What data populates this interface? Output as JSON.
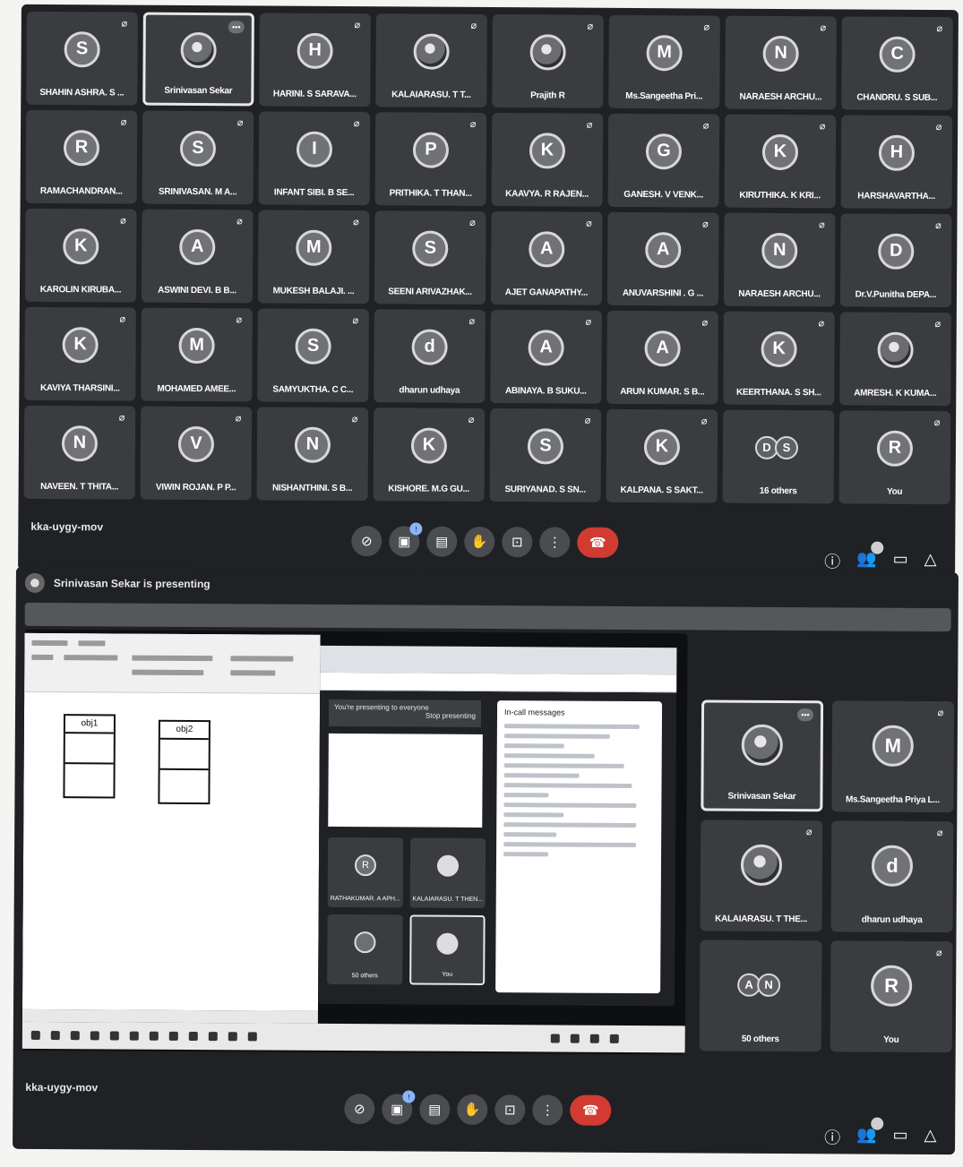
{
  "top": {
    "participants": [
      {
        "initial": "S",
        "name": "SHAHIN ASHRA. S ..."
      },
      {
        "initial": "",
        "name": "Srinivasan Sekar",
        "photo": true,
        "active": true,
        "more": "•••"
      },
      {
        "initial": "H",
        "name": "HARINI. S SARAVA..."
      },
      {
        "initial": "",
        "name": "KALAIARASU. T T...",
        "photo": true
      },
      {
        "initial": "",
        "name": "Prajith R",
        "photo": true
      },
      {
        "initial": "M",
        "name": "Ms.Sangeetha Pri..."
      },
      {
        "initial": "N",
        "name": "NARAESH ARCHU..."
      },
      {
        "initial": "C",
        "name": "CHANDRU. S SUB..."
      },
      {
        "initial": "R",
        "name": "RAMACHANDRAN..."
      },
      {
        "initial": "S",
        "name": "SRINIVASAN. M A..."
      },
      {
        "initial": "I",
        "name": "INFANT SIBI. B SE..."
      },
      {
        "initial": "P",
        "name": "PRITHIKA. T THAN..."
      },
      {
        "initial": "K",
        "name": "KAAVYA. R RAJEN..."
      },
      {
        "initial": "G",
        "name": "GANESH. V VENK..."
      },
      {
        "initial": "K",
        "name": "KIRUTHIKA. K KRI..."
      },
      {
        "initial": "H",
        "name": "HARSHAVARTHA..."
      },
      {
        "initial": "K",
        "name": "KAROLIN KIRUBA..."
      },
      {
        "initial": "A",
        "name": "ASWINI DEVI. B B..."
      },
      {
        "initial": "M",
        "name": "MUKESH BALAJI. ..."
      },
      {
        "initial": "S",
        "name": "SEENI ARIVAZHAK..."
      },
      {
        "initial": "A",
        "name": "AJET GANAPATHY..."
      },
      {
        "initial": "A",
        "name": "ANUVARSHINI . G ..."
      },
      {
        "initial": "N",
        "name": "NARAESH ARCHU..."
      },
      {
        "initial": "D",
        "name": "Dr.V.Punitha DEPA..."
      },
      {
        "initial": "K",
        "name": "KAVIYA THARSINI..."
      },
      {
        "initial": "M",
        "name": "MOHAMED AMEE..."
      },
      {
        "initial": "S",
        "name": "SAMYUKTHA. C C..."
      },
      {
        "initial": "d",
        "name": "dharun udhaya"
      },
      {
        "initial": "A",
        "name": "ABINAYA. B SUKU..."
      },
      {
        "initial": "A",
        "name": "ARUN KUMAR. S B..."
      },
      {
        "initial": "K",
        "name": "KEERTHANA. S SH..."
      },
      {
        "initial": "",
        "name": "AMRESH. K KUMA...",
        "photo": true
      },
      {
        "initial": "N",
        "name": "NAVEEN. T THITA..."
      },
      {
        "initial": "V",
        "name": "VIWIN ROJAN. P P..."
      },
      {
        "initial": "N",
        "name": "NISHANTHINI. S B..."
      },
      {
        "initial": "K",
        "name": "KISHORE. M.G GU..."
      },
      {
        "initial": "S",
        "name": "SURIYANAD. S SN..."
      },
      {
        "initial": "K",
        "name": "KALPANA. S SAKT..."
      },
      {
        "initial": "",
        "name": "16 others",
        "duo": [
          "D",
          "S"
        ],
        "nomic": true
      },
      {
        "initial": "R",
        "name": "You"
      }
    ],
    "meeting_code": "kka-uygy-mov",
    "presenting_banner": "Srinivasan Sekar is presenting"
  },
  "bottom": {
    "meeting_code": "kka-uygy-mov",
    "paint_objects": [
      "obj1",
      "obj2"
    ],
    "browser_presenting_text": "You're presenting to everyone",
    "browser_stop_text": "Stop presenting",
    "chat_title": "In-call messages",
    "browser_tiles": [
      {
        "initial": "R",
        "name": "RATHAKUMAR. A APH..."
      },
      {
        "initial": "",
        "name": "KALAIARASU. T THEN..."
      },
      {
        "initial": "",
        "name": "50 others"
      },
      {
        "initial": "",
        "name": "You"
      }
    ],
    "side_participants": [
      {
        "initial": "",
        "name": "Srinivasan Sekar",
        "photo": true,
        "active": true,
        "more": "•••",
        "nomic": true
      },
      {
        "initial": "M",
        "name": "Ms.Sangeetha Priya L..."
      },
      {
        "initial": "",
        "name": "KALAIARASU. T THE...",
        "photo": true
      },
      {
        "initial": "d",
        "name": "dharun udhaya"
      },
      {
        "initial": "",
        "name": "50 others",
        "duo": [
          "A",
          "N"
        ],
        "nomic": true
      },
      {
        "initial": "R",
        "name": "You"
      }
    ]
  },
  "controls": {
    "icons": [
      "mic-off-icon",
      "camera-off-icon",
      "captions-icon",
      "raise-hand-icon",
      "present-icon",
      "more-options-icon",
      "leave-call-icon"
    ],
    "side_icons": [
      "info-icon",
      "people-icon",
      "chat-icon",
      "activities-icon"
    ],
    "people_count": "",
    "camera_badge": "!"
  },
  "colors": {
    "panel": "#1f2124",
    "tile": "#3a3c40",
    "leave": "#d23b31",
    "accent": "#8ab4f8"
  }
}
